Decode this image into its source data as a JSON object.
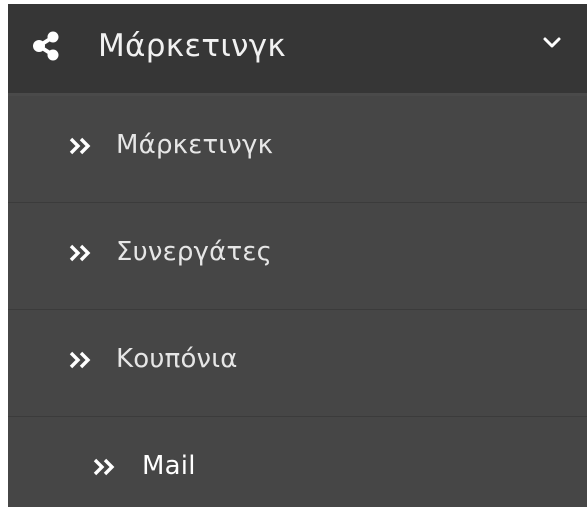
{
  "menu": {
    "header": {
      "title": "Μάρκετινγκ",
      "icon": "share-icon",
      "toggle_icon": "chevron-down-icon"
    },
    "items": [
      {
        "label": "Μάρκετινγκ",
        "icon": "double-chevron-right-icon"
      },
      {
        "label": "Συνεργάτες",
        "icon": "double-chevron-right-icon"
      },
      {
        "label": "Κουπόνια",
        "icon": "double-chevron-right-icon"
      },
      {
        "label": "Mail",
        "icon": "double-chevron-right-icon"
      }
    ]
  },
  "colors": {
    "header_background": "#363636",
    "menu_background": "#464646",
    "text": "#f1f1f1",
    "divider": "#3b3b3b"
  }
}
